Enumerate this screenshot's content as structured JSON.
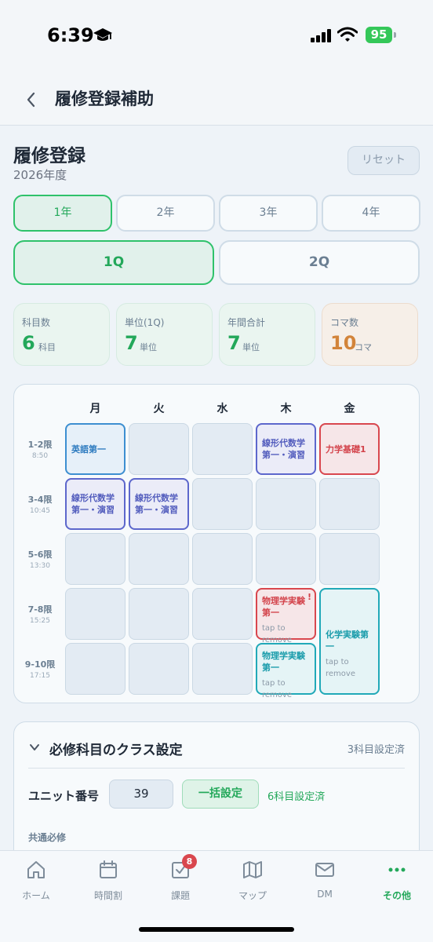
{
  "status_bar": {
    "time": "6:39",
    "battery": "95"
  },
  "nav": {
    "title": "履修登録補助",
    "back_icon": "chevron-left-icon"
  },
  "header": {
    "title": "履修登録",
    "year": "2026年度",
    "reset_label": "リセット"
  },
  "year_tabs": [
    {
      "label": "1年",
      "active": true
    },
    {
      "label": "2年",
      "active": false
    },
    {
      "label": "3年",
      "active": false
    },
    {
      "label": "4年",
      "active": false
    }
  ],
  "quarter_tabs": [
    {
      "label": "1Q",
      "active": true
    },
    {
      "label": "2Q",
      "active": false
    }
  ],
  "stats": [
    {
      "label": "科目数",
      "value": "6",
      "unit": "科目"
    },
    {
      "label": "単位(1Q)",
      "value": "7",
      "unit": "単位"
    },
    {
      "label": "年間合計",
      "value": "7",
      "unit": "単位"
    },
    {
      "label": "コマ数",
      "value": "10",
      "unit": "コマ"
    }
  ],
  "timetable": {
    "days": [
      "月",
      "火",
      "水",
      "木",
      "金"
    ],
    "periods": [
      {
        "label": "1-2限",
        "time": "8:50"
      },
      {
        "label": "3-4限",
        "time": "10:45"
      },
      {
        "label": "5-6限",
        "time": "13:30"
      },
      {
        "label": "7-8限",
        "time": "15:25"
      },
      {
        "label": "9-10限",
        "time": "17:15"
      }
    ],
    "courses": [
      {
        "name": "英語第一",
        "day": 0,
        "period": 0,
        "span": 1,
        "color": "blue"
      },
      {
        "name": "線形代数学第一・演習",
        "day": 3,
        "period": 0,
        "span": 1,
        "color": "purple"
      },
      {
        "name": "力学基礎1",
        "day": 4,
        "period": 0,
        "span": 1,
        "color": "red"
      },
      {
        "name": "線形代数学第一・演習",
        "day": 0,
        "period": 1,
        "span": 1,
        "color": "purple"
      },
      {
        "name": "線形代数学第一・演習",
        "day": 1,
        "period": 1,
        "span": 1,
        "color": "purple"
      },
      {
        "name": "物理学実験第一",
        "day": 3,
        "period": 3,
        "span": 1,
        "color": "red",
        "note": "tap to remove",
        "warning": "!"
      },
      {
        "name": "化学実験第一",
        "day": 4,
        "period": 3,
        "span": 2,
        "color": "teal",
        "note": "tap to remove"
      },
      {
        "name": "物理学実験第一",
        "day": 3,
        "period": 4,
        "span": 1,
        "color": "teal",
        "note": "tap to remove"
      }
    ],
    "colors": {
      "blue": "#3d8fd1",
      "purple": "#5d67cc",
      "red": "#d9474e",
      "teal": "#21a9b8"
    }
  },
  "class_settings": {
    "title": "必修科目のクラス設定",
    "count": "3科目設定済",
    "unit_label": "ユニット番号",
    "unit_value": "39",
    "bulk_label": "一括設定",
    "bulk_status": "6科目設定済",
    "section": "共通必修"
  },
  "tab_bar": [
    {
      "label": "ホーム",
      "icon": "home-icon"
    },
    {
      "label": "時間割",
      "icon": "calendar-icon"
    },
    {
      "label": "課題",
      "icon": "task-icon",
      "badge": "8"
    },
    {
      "label": "マップ",
      "icon": "map-icon"
    },
    {
      "label": "DM",
      "icon": "mail-icon"
    },
    {
      "label": "その他",
      "icon": "more-icon",
      "active": true
    }
  ],
  "accent_color": "#23a85a"
}
